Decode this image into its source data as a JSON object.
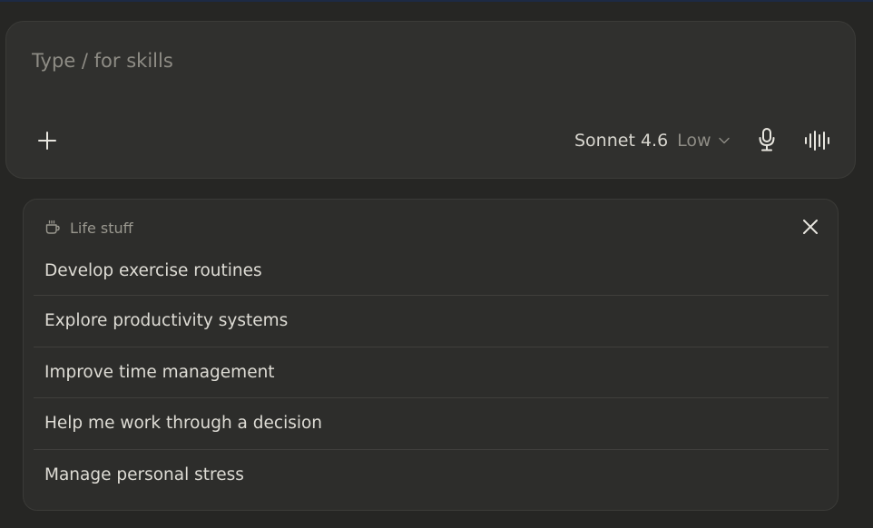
{
  "composer": {
    "placeholder": "Type / for skills",
    "plus_icon": "plus-icon",
    "model": "Sonnet 4.6",
    "effort": "Low",
    "mic_icon": "microphone-icon",
    "voice_icon": "voice-waveform-icon"
  },
  "suggestions": {
    "category_icon": "coffee-cup-icon",
    "title": "Life stuff",
    "close_icon": "close-icon",
    "items": [
      {
        "label": "Develop exercise routines"
      },
      {
        "label": "Explore productivity systems"
      },
      {
        "label": "Improve time management"
      },
      {
        "label": "Help me work through a decision"
      },
      {
        "label": "Manage personal stress"
      }
    ]
  },
  "colors": {
    "background": "#262624",
    "panel": "#30302e",
    "text": "#e8e6df",
    "muted": "#8e8c85"
  }
}
